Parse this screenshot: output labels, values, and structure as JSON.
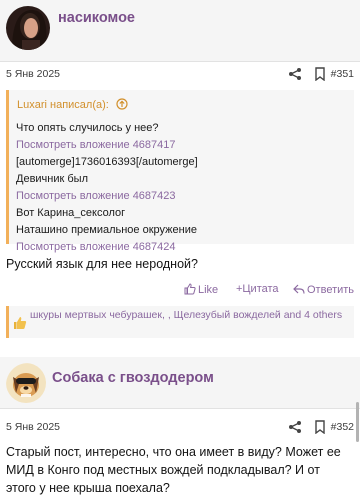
{
  "post1": {
    "username": "насикомое",
    "date": "5 Янв 2025",
    "number": "#351",
    "quote": {
      "header": "Luxari написал(а):",
      "lines": [
        {
          "text": "Что опять случилось у нее?",
          "kind": "text"
        },
        {
          "text": "Посмотреть вложение 4687417",
          "kind": "link"
        },
        {
          "text": "[automerge]1736016393[/automerge]",
          "kind": "text"
        },
        {
          "text": "Девичник был",
          "kind": "text"
        },
        {
          "text": "Посмотреть вложение 4687423",
          "kind": "link"
        },
        {
          "text": "Вот Карина_сексолог",
          "kind": "text"
        },
        {
          "text": "Наташино премиальное окружение",
          "kind": "text"
        },
        {
          "text": "Посмотреть вложение 4687424",
          "kind": "link"
        }
      ]
    },
    "body": "Русский язык для нее неродной?",
    "actions": {
      "like": "Like",
      "quote": "+Цитата",
      "reply": "Ответить"
    },
    "reactions": "шкуры мертвых чебурашек,        , Щелезубый вожделей and 4 others"
  },
  "post2": {
    "username": "Собака с гвоздодером",
    "date": "5 Янв 2025",
    "number": "#352",
    "body": "Старый пост, интересно, что она имеет в виду? Может ее МИД в Конго под местных вождей подкладывал? И от этого у нее крыша поехала?"
  },
  "colors": {
    "accent": "#8b69a0",
    "quote_border": "#f2b05a",
    "quote_header": "#d2902c"
  }
}
